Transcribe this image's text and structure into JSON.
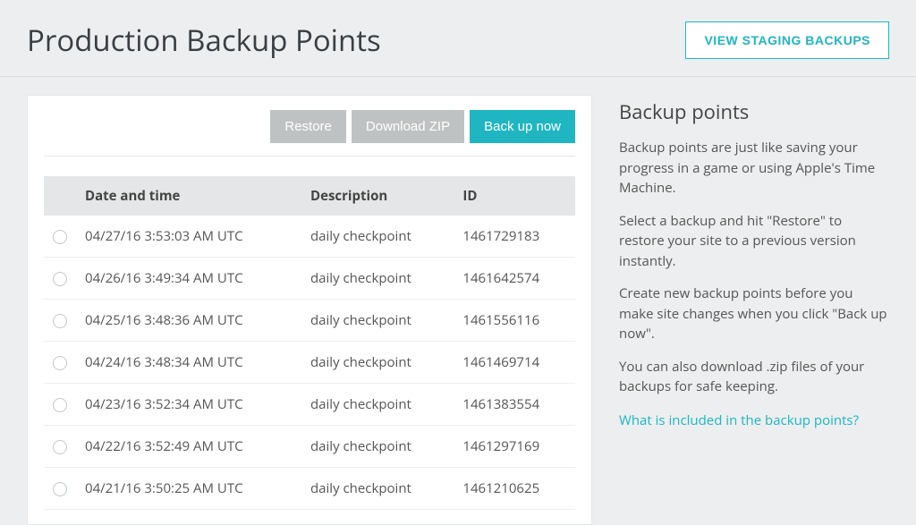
{
  "header": {
    "title": "Production Backup Points",
    "view_staging_label": "VIEW STAGING BACKUPS"
  },
  "toolbar": {
    "restore_label": "Restore",
    "download_label": "Download ZIP",
    "backup_now_label": "Back up now"
  },
  "table": {
    "columns": {
      "datetime": "Date and time",
      "description": "Description",
      "id": "ID"
    },
    "rows": [
      {
        "datetime": "04/27/16 3:53:03 AM UTC",
        "description": "daily checkpoint",
        "id": "1461729183"
      },
      {
        "datetime": "04/26/16 3:49:34 AM UTC",
        "description": "daily checkpoint",
        "id": "1461642574"
      },
      {
        "datetime": "04/25/16 3:48:36 AM UTC",
        "description": "daily checkpoint",
        "id": "1461556116"
      },
      {
        "datetime": "04/24/16 3:48:34 AM UTC",
        "description": "daily checkpoint",
        "id": "1461469714"
      },
      {
        "datetime": "04/23/16 3:52:34 AM UTC",
        "description": "daily checkpoint",
        "id": "1461383554"
      },
      {
        "datetime": "04/22/16 3:52:49 AM UTC",
        "description": "daily checkpoint",
        "id": "1461297169"
      },
      {
        "datetime": "04/21/16 3:50:25 AM UTC",
        "description": "daily checkpoint",
        "id": "1461210625"
      }
    ]
  },
  "sidebar": {
    "heading": "Backup points",
    "p1": "Backup points are just like saving your progress in a game or using Apple's Time Machine.",
    "p2": "Select a backup and hit \"Restore\" to restore your site to a previous version instantly.",
    "p3": "Create new backup points before you make site changes when you click \"Back up now\".",
    "p4": "You can also download .zip files of your backups for safe keeping.",
    "link": "What is included in the backup points?"
  }
}
